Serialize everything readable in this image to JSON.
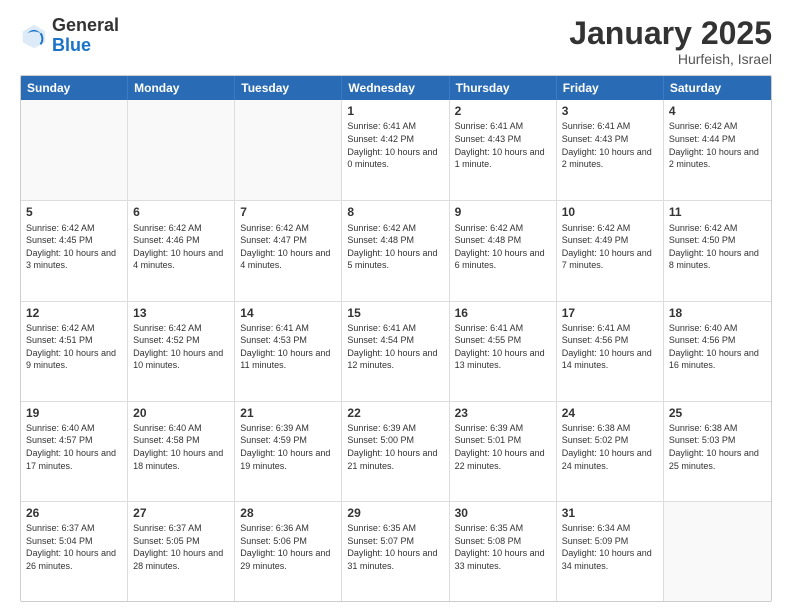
{
  "header": {
    "logo_general": "General",
    "logo_blue": "Blue",
    "month_title": "January 2025",
    "location": "Hurfeish, Israel"
  },
  "day_headers": [
    "Sunday",
    "Monday",
    "Tuesday",
    "Wednesday",
    "Thursday",
    "Friday",
    "Saturday"
  ],
  "weeks": [
    [
      {
        "day": "",
        "empty": true
      },
      {
        "day": "",
        "empty": true
      },
      {
        "day": "",
        "empty": true
      },
      {
        "day": "1",
        "sunrise": "6:41 AM",
        "sunset": "4:42 PM",
        "daylight": "10 hours and 0 minutes."
      },
      {
        "day": "2",
        "sunrise": "6:41 AM",
        "sunset": "4:43 PM",
        "daylight": "10 hours and 1 minute."
      },
      {
        "day": "3",
        "sunrise": "6:41 AM",
        "sunset": "4:43 PM",
        "daylight": "10 hours and 2 minutes."
      },
      {
        "day": "4",
        "sunrise": "6:42 AM",
        "sunset": "4:44 PM",
        "daylight": "10 hours and 2 minutes."
      }
    ],
    [
      {
        "day": "5",
        "sunrise": "6:42 AM",
        "sunset": "4:45 PM",
        "daylight": "10 hours and 3 minutes."
      },
      {
        "day": "6",
        "sunrise": "6:42 AM",
        "sunset": "4:46 PM",
        "daylight": "10 hours and 4 minutes."
      },
      {
        "day": "7",
        "sunrise": "6:42 AM",
        "sunset": "4:47 PM",
        "daylight": "10 hours and 4 minutes."
      },
      {
        "day": "8",
        "sunrise": "6:42 AM",
        "sunset": "4:48 PM",
        "daylight": "10 hours and 5 minutes."
      },
      {
        "day": "9",
        "sunrise": "6:42 AM",
        "sunset": "4:48 PM",
        "daylight": "10 hours and 6 minutes."
      },
      {
        "day": "10",
        "sunrise": "6:42 AM",
        "sunset": "4:49 PM",
        "daylight": "10 hours and 7 minutes."
      },
      {
        "day": "11",
        "sunrise": "6:42 AM",
        "sunset": "4:50 PM",
        "daylight": "10 hours and 8 minutes."
      }
    ],
    [
      {
        "day": "12",
        "sunrise": "6:42 AM",
        "sunset": "4:51 PM",
        "daylight": "10 hours and 9 minutes."
      },
      {
        "day": "13",
        "sunrise": "6:42 AM",
        "sunset": "4:52 PM",
        "daylight": "10 hours and 10 minutes."
      },
      {
        "day": "14",
        "sunrise": "6:41 AM",
        "sunset": "4:53 PM",
        "daylight": "10 hours and 11 minutes."
      },
      {
        "day": "15",
        "sunrise": "6:41 AM",
        "sunset": "4:54 PM",
        "daylight": "10 hours and 12 minutes."
      },
      {
        "day": "16",
        "sunrise": "6:41 AM",
        "sunset": "4:55 PM",
        "daylight": "10 hours and 13 minutes."
      },
      {
        "day": "17",
        "sunrise": "6:41 AM",
        "sunset": "4:56 PM",
        "daylight": "10 hours and 14 minutes."
      },
      {
        "day": "18",
        "sunrise": "6:40 AM",
        "sunset": "4:56 PM",
        "daylight": "10 hours and 16 minutes."
      }
    ],
    [
      {
        "day": "19",
        "sunrise": "6:40 AM",
        "sunset": "4:57 PM",
        "daylight": "10 hours and 17 minutes."
      },
      {
        "day": "20",
        "sunrise": "6:40 AM",
        "sunset": "4:58 PM",
        "daylight": "10 hours and 18 minutes."
      },
      {
        "day": "21",
        "sunrise": "6:39 AM",
        "sunset": "4:59 PM",
        "daylight": "10 hours and 19 minutes."
      },
      {
        "day": "22",
        "sunrise": "6:39 AM",
        "sunset": "5:00 PM",
        "daylight": "10 hours and 21 minutes."
      },
      {
        "day": "23",
        "sunrise": "6:39 AM",
        "sunset": "5:01 PM",
        "daylight": "10 hours and 22 minutes."
      },
      {
        "day": "24",
        "sunrise": "6:38 AM",
        "sunset": "5:02 PM",
        "daylight": "10 hours and 24 minutes."
      },
      {
        "day": "25",
        "sunrise": "6:38 AM",
        "sunset": "5:03 PM",
        "daylight": "10 hours and 25 minutes."
      }
    ],
    [
      {
        "day": "26",
        "sunrise": "6:37 AM",
        "sunset": "5:04 PM",
        "daylight": "10 hours and 26 minutes."
      },
      {
        "day": "27",
        "sunrise": "6:37 AM",
        "sunset": "5:05 PM",
        "daylight": "10 hours and 28 minutes."
      },
      {
        "day": "28",
        "sunrise": "6:36 AM",
        "sunset": "5:06 PM",
        "daylight": "10 hours and 29 minutes."
      },
      {
        "day": "29",
        "sunrise": "6:35 AM",
        "sunset": "5:07 PM",
        "daylight": "10 hours and 31 minutes."
      },
      {
        "day": "30",
        "sunrise": "6:35 AM",
        "sunset": "5:08 PM",
        "daylight": "10 hours and 33 minutes."
      },
      {
        "day": "31",
        "sunrise": "6:34 AM",
        "sunset": "5:09 PM",
        "daylight": "10 hours and 34 minutes."
      },
      {
        "day": "",
        "empty": true
      }
    ]
  ]
}
